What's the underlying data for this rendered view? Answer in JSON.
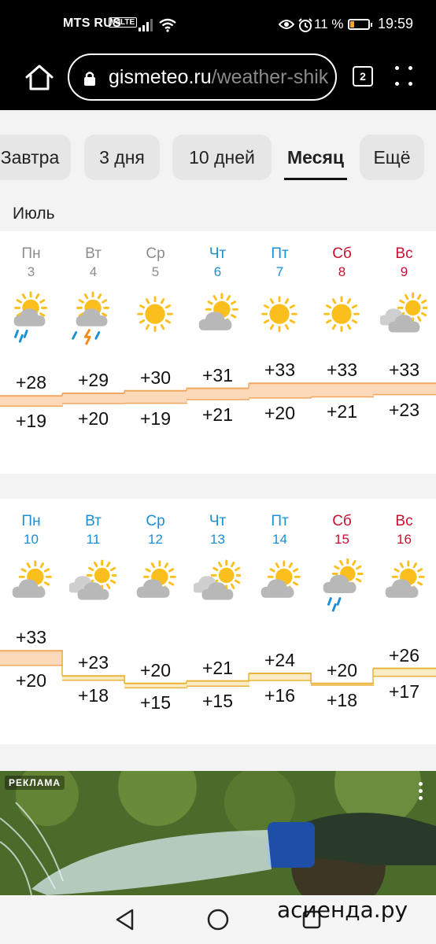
{
  "status_bar": {
    "carrier": "MTS RUS",
    "volte": "VoLTE",
    "battery_percent": "11 %",
    "time": "19:59"
  },
  "browser": {
    "url_main": "gismeteo.ru",
    "url_rest": "/weather-shik",
    "tab_count": "2"
  },
  "period_tabs": [
    {
      "label": "Завтра",
      "active": false
    },
    {
      "label": "3 дня",
      "active": false
    },
    {
      "label": "10 дней",
      "active": false
    },
    {
      "label": "Месяц",
      "active": true
    },
    {
      "label": "Ещё",
      "active": false
    }
  ],
  "month": "Июль",
  "weeks": [
    {
      "days": [
        {
          "name": "Пн",
          "date": "3",
          "color": "past",
          "icon": "partly-cloudy-rain-icon",
          "high": "+28",
          "low": "+19"
        },
        {
          "name": "Вт",
          "date": "4",
          "color": "past",
          "icon": "partly-cloudy-thunderstorm-icon",
          "high": "+29",
          "low": "+20"
        },
        {
          "name": "Ср",
          "date": "5",
          "color": "past",
          "icon": "sun-icon",
          "high": "+30",
          "low": "+19"
        },
        {
          "name": "Чт",
          "date": "6",
          "color": "blue",
          "icon": "sun-behind-cloud-icon",
          "high": "+31",
          "low": "+21"
        },
        {
          "name": "Пт",
          "date": "7",
          "color": "blue",
          "icon": "sun-icon",
          "high": "+33",
          "low": "+20"
        },
        {
          "name": "Сб",
          "date": "8",
          "color": "red",
          "icon": "sun-icon",
          "high": "+33",
          "low": "+21"
        },
        {
          "name": "Вс",
          "date": "9",
          "color": "red",
          "icon": "cloudy-sun-icon",
          "high": "+33",
          "low": "+23"
        }
      ]
    },
    {
      "days": [
        {
          "name": "Пн",
          "date": "10",
          "color": "blue",
          "icon": "sun-behind-cloud-icon",
          "high": "+33",
          "low": "+20"
        },
        {
          "name": "Вт",
          "date": "11",
          "color": "blue",
          "icon": "cloudy-sun-icon",
          "high": "+23",
          "low": "+18"
        },
        {
          "name": "Ср",
          "date": "12",
          "color": "blue",
          "icon": "sun-behind-cloud-icon",
          "high": "+20",
          "low": "+15"
        },
        {
          "name": "Чт",
          "date": "13",
          "color": "blue",
          "icon": "cloudy-sun-icon",
          "high": "+21",
          "low": "+15"
        },
        {
          "name": "Пт",
          "date": "14",
          "color": "blue",
          "icon": "sun-behind-cloud-icon",
          "high": "+24",
          "low": "+16"
        },
        {
          "name": "Сб",
          "date": "15",
          "color": "red",
          "icon": "cloud-rain-icon",
          "high": "+20",
          "low": "+18"
        },
        {
          "name": "Вс",
          "date": "16",
          "color": "red",
          "icon": "sun-behind-cloud-icon",
          "high": "+26",
          "low": "+17"
        }
      ]
    }
  ],
  "ad": {
    "label": "РЕКЛАМА"
  },
  "watermark": "асиенда.ру",
  "colors": {
    "past": "#8c8c8c",
    "blue": "#1a8fd4",
    "red": "#c8102e",
    "sun": "#fbbf1d",
    "cloud": "#b8b8b8",
    "rain": "#1a8fd4",
    "band_fill_hot": "#fcd9b8",
    "band_line_hot": "#f0a860",
    "band_fill_warm": "#fbecc6",
    "band_line_warm": "#e8b43a"
  }
}
